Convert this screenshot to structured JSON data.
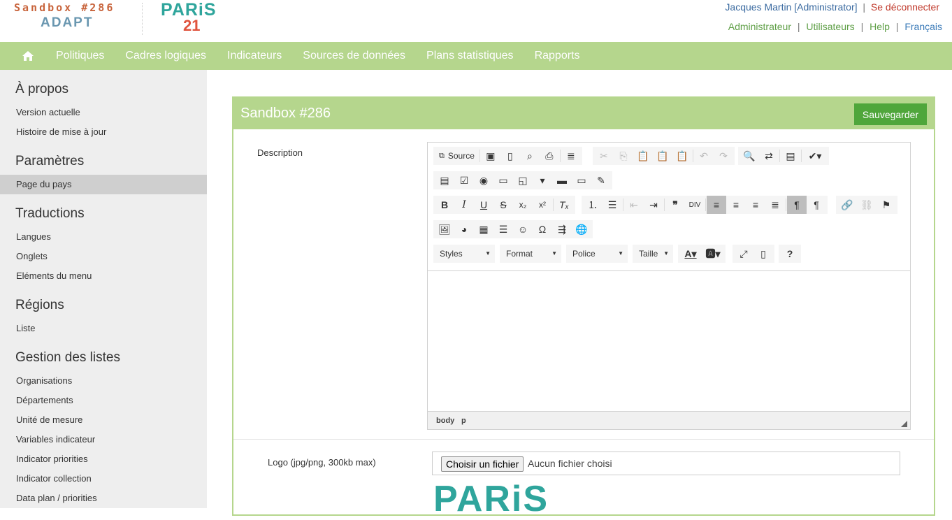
{
  "header": {
    "brand_sandbox": "Sandbox #286",
    "brand_adapt": "ADAPT",
    "logo_paris": "PARiS",
    "logo_21": "21",
    "user": "Jacques Martin [Administrator]",
    "sep": "|",
    "logout": "Se déconnecter",
    "links": {
      "admin": "Administrateur",
      "users": "Utilisateurs",
      "help": "Help",
      "lang": "Français"
    }
  },
  "nav": {
    "home_icon": "home-icon",
    "items": [
      "Politiques",
      "Cadres logiques",
      "Indicateurs",
      "Sources de données",
      "Plans statistiques",
      "Rapports"
    ]
  },
  "sidebar": {
    "sections": [
      {
        "heading": "À propos",
        "items": [
          "Version actuelle",
          "Histoire de mise à jour"
        ]
      },
      {
        "heading": "Paramètres",
        "items": [
          "Page du pays"
        ]
      },
      {
        "heading": "Traductions",
        "items": [
          "Langues",
          "Onglets",
          "Eléments du menu"
        ]
      },
      {
        "heading": "Régions",
        "items": [
          "Liste"
        ]
      },
      {
        "heading": "Gestion des listes",
        "items": [
          "Organisations",
          "Départements",
          "Unité de mesure",
          "Variables indicateur",
          "Indicator priorities",
          "Indicator collection",
          "Data plan / priorities"
        ]
      }
    ],
    "active_item": "Page du pays"
  },
  "panel": {
    "title": "Sandbox #286",
    "save_label": "Sauvegarder",
    "description_label": "Description",
    "editor": {
      "source_label": "Source",
      "combos": {
        "styles": "Styles",
        "format": "Format",
        "font": "Police",
        "size": "Taille"
      },
      "path": {
        "body": "body",
        "p": "p"
      }
    },
    "logo_label": "Logo (jpg/png, 300kb max)",
    "file_button": "Choisir un fichier",
    "file_none": "Aucun fichier choisi",
    "logo_preview": "PARiS"
  },
  "colors": {
    "accent_green": "#b5d68d",
    "save_green": "#4fa63b",
    "brand_orange": "#c8643c",
    "brand_teal": "#2fa59c",
    "logout_red": "#c0392b"
  }
}
